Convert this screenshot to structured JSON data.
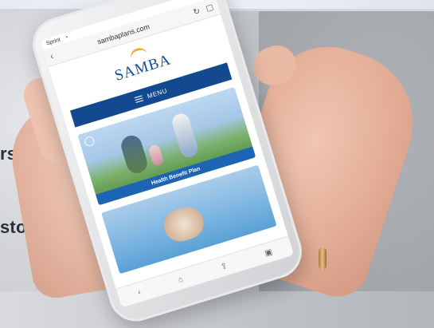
{
  "overlay": {
    "line1": "rs",
    "line2": "story"
  },
  "phone": {
    "status_carrier": "Sprint",
    "url": "sambaplans.com",
    "logo_text": "SAMBA",
    "logo_tagline": "",
    "menu_label": "MENU",
    "card1_label": "Health Benefit Plan"
  },
  "colors": {
    "brand_blue": "#134a8f",
    "card_bar_blue": "#1d64b4",
    "logo_sun": "#e1b537"
  },
  "icons": {
    "back": "chevron-left-icon",
    "reload": "refresh-icon",
    "bookmarks": "bookmarks-icon",
    "home": "home-icon",
    "share": "share-icon",
    "tabs": "tabs-icon",
    "search": "search-icon"
  }
}
